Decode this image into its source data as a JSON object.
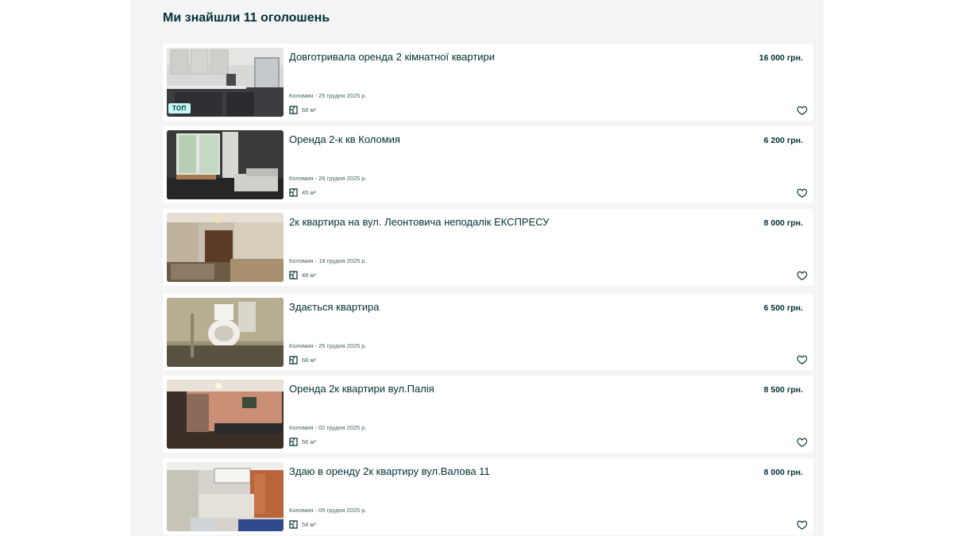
{
  "heading": "Ми знайшли 11 оголошень",
  "top_badge": "ТОП",
  "listings": [
    {
      "title": "Довготривала оренда 2 кімнатної квартири",
      "price": "16 000 грн.",
      "meta": "Коломия - 25 грудня 2025 р.",
      "area": "68 м²",
      "top": true
    },
    {
      "title": "Оренда 2-к кв Коломия",
      "price": "6 200 грн.",
      "meta": "Коломия - 26 грудня 2025 р.",
      "area": "45 м²",
      "top": false
    },
    {
      "title": "2к квартира на вул. Леонтовича неподалік ЕКСПРЕСУ",
      "price": "8 000 грн.",
      "meta": "Коломия - 18 грудня 2025 р.",
      "area": "48 м²",
      "top": false
    },
    {
      "title": "Здається квартира",
      "price": "6 500 грн.",
      "meta": "Коломия - 25 грудня 2025 р.",
      "area": "68 м²",
      "top": false
    },
    {
      "title": "Оренда 2к квартири вул.Палія",
      "price": "8 500 грн.",
      "meta": "Коломия - 02 грудня 2025 р.",
      "area": "56 м²",
      "top": false
    },
    {
      "title": "Здаю в оренду 2к квартиру вул.Валова 11",
      "price": "8 000 грн.",
      "meta": "Коломия - 05 грудня 2025 р.",
      "area": "54 м²",
      "top": false
    }
  ],
  "icons": {
    "area": "floor-plan-icon",
    "favorite": "heart-icon"
  }
}
